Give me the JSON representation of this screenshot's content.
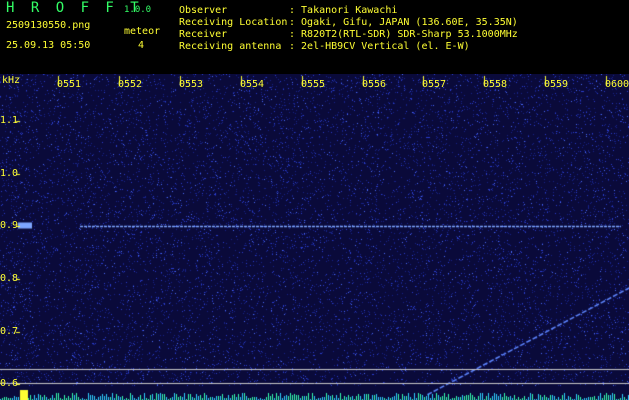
{
  "header": {
    "app_title": "H R O F F T",
    "app_version": "1.0.0",
    "filename": "2509130550.png",
    "datetime": "25.09.13 05:50",
    "meteor_label": "meteor",
    "meteor_count": "4",
    "info": [
      {
        "label": "Observer",
        "value": ": Takanori Kawachi"
      },
      {
        "label": "Receiving Location",
        "value": ": Ogaki, Gifu, JAPAN (136.60E, 35.35N)"
      },
      {
        "label": "Receiver",
        "value": ": R820T2(RTL-SDR) SDR-Sharp 53.1000MHz"
      },
      {
        "label": "Receiving antenna",
        "value": ": 2el-HB9CV Vertical (el. E-W)"
      }
    ]
  },
  "chart_data": {
    "type": "heatmap",
    "ylabel": "kHz",
    "x_ticks": [
      "0551",
      "0552",
      "0553",
      "0554",
      "0555",
      "0556",
      "0557",
      "0558",
      "0559",
      "0600"
    ],
    "y_ticks": [
      "1.1",
      "1.0",
      "0.9",
      "0.8",
      "0.7",
      "0.6"
    ],
    "ylim": [
      0.57,
      1.19
    ],
    "carrier_khz": 0.9,
    "drifting_signal": {
      "start": [
        "0557",
        0.58
      ],
      "end": [
        "0600",
        0.79
      ]
    },
    "colors": {
      "background": "#0a0a3a",
      "noise": "#2b3fd0",
      "signal": "#7ea6ff",
      "axis_text": "#ffff33"
    }
  }
}
